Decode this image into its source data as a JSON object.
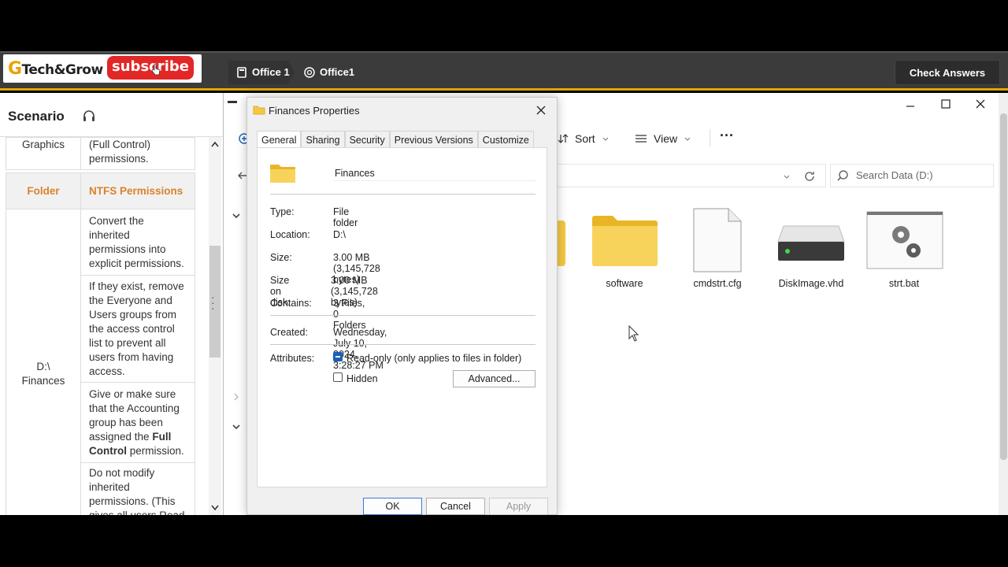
{
  "brand": {
    "name": "Tech&Grow",
    "initial": "G",
    "subscribe": "subscribe"
  },
  "lab_tabs": [
    {
      "label": "Office 1",
      "icon": "vm-icon"
    },
    {
      "label": "Office1",
      "icon": "network-icon"
    }
  ],
  "check_answers": "Check Answers",
  "scenario": {
    "title": "Scenario",
    "partial_rows": {
      "left": "Graphics",
      "right": "(Full Control) permissions."
    },
    "headers": {
      "folder": "Folder",
      "perms": "NTFS Permissions"
    },
    "folder_name": "D:\\ Finances",
    "items": [
      "Convert the inherited permissions into explicit permissions.",
      "If they exist, remove the Everyone and Users groups from the access control list to prevent all users from having access.",
      "Give or make sure that the Accounting group has been assigned the",
      "Do not modify inherited permissions. (This gives all users Read"
    ],
    "bold_full_control": "Full Control",
    "perm_suffix": " permission."
  },
  "explorer": {
    "sort": "Sort",
    "view": "View",
    "more": "···",
    "search_placeholder": "Search Data (D:)",
    "files": [
      {
        "name": "software",
        "icon": "folder-icon"
      },
      {
        "name": "cmdstrt.cfg",
        "icon": "document-icon"
      },
      {
        "name": "DiskImage.vhd",
        "icon": "disk-icon"
      },
      {
        "name": "strt.bat",
        "icon": "gear-file-icon"
      }
    ]
  },
  "dialog": {
    "title": "Finances Properties",
    "tabs": [
      "General",
      "Sharing",
      "Security",
      "Previous Versions",
      "Customize"
    ],
    "name": "Finances",
    "type_label": "Type:",
    "type_value": "File folder",
    "location_label": "Location:",
    "location_value": "D:\\",
    "size_label": "Size:",
    "size_value": "3.00 MB (3,145,728 bytes)",
    "size_disk_label": "Size on disk:",
    "size_disk_value": "3.00 MB (3,145,728 bytes)",
    "contains_label": "Contains:",
    "contains_value": "3 Files, 0 Folders",
    "created_label": "Created:",
    "created_value": "Wednesday, July 10, 2024, 3:28:27 PM",
    "attributes_label": "Attributes:",
    "readonly_label": "Read-only (only applies to files in folder)",
    "hidden_label": "Hidden",
    "advanced": "Advanced...",
    "ok": "OK",
    "cancel": "Cancel",
    "apply": "Apply"
  }
}
